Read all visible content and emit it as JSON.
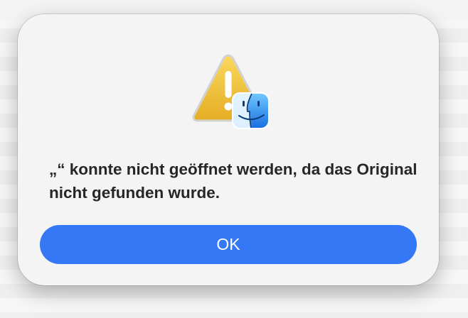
{
  "dialog": {
    "message": "„“ konnte nicht geöffnet werden, da das Original nicht gefunden wurde.",
    "ok_label": "OK"
  },
  "icons": {
    "warning": "warning-triangle-icon",
    "badge": "finder-icon"
  },
  "colors": {
    "accent": "#3478f6",
    "warning_yellow": "#f2c23a",
    "finder_blue": "#1e88f0",
    "text": "#262626"
  }
}
